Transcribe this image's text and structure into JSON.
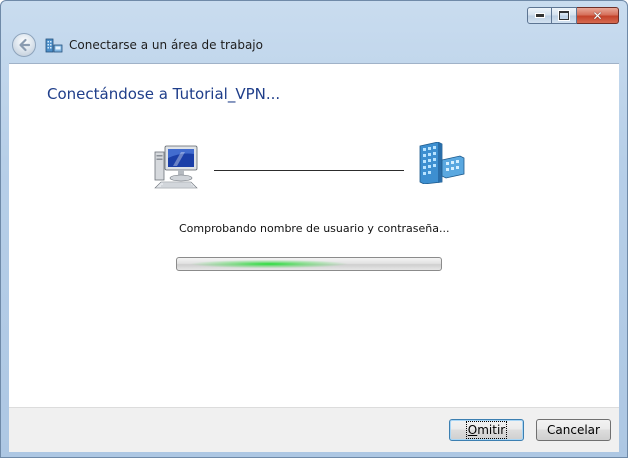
{
  "window": {
    "title": "Conectarse a un área de trabajo",
    "caption_buttons": {
      "minimize": "minimize-icon",
      "maximize": "maximize-icon",
      "close": "close-icon"
    }
  },
  "main": {
    "heading": "Conectándose a Tutorial_VPN...",
    "status": "Comprobando nombre de usuario y contraseña...",
    "progress": {
      "type": "indeterminate",
      "position": 0.35
    },
    "icons": {
      "local": "computer-icon",
      "remote": "server-icon"
    }
  },
  "footer": {
    "skip_mnemonic": "O",
    "skip_rest": "mitir",
    "cancel_label": "Cancelar"
  },
  "colors": {
    "heading": "#1f3e8a",
    "progress_glow": "#28dc3c",
    "close_button": "#c4422a"
  }
}
